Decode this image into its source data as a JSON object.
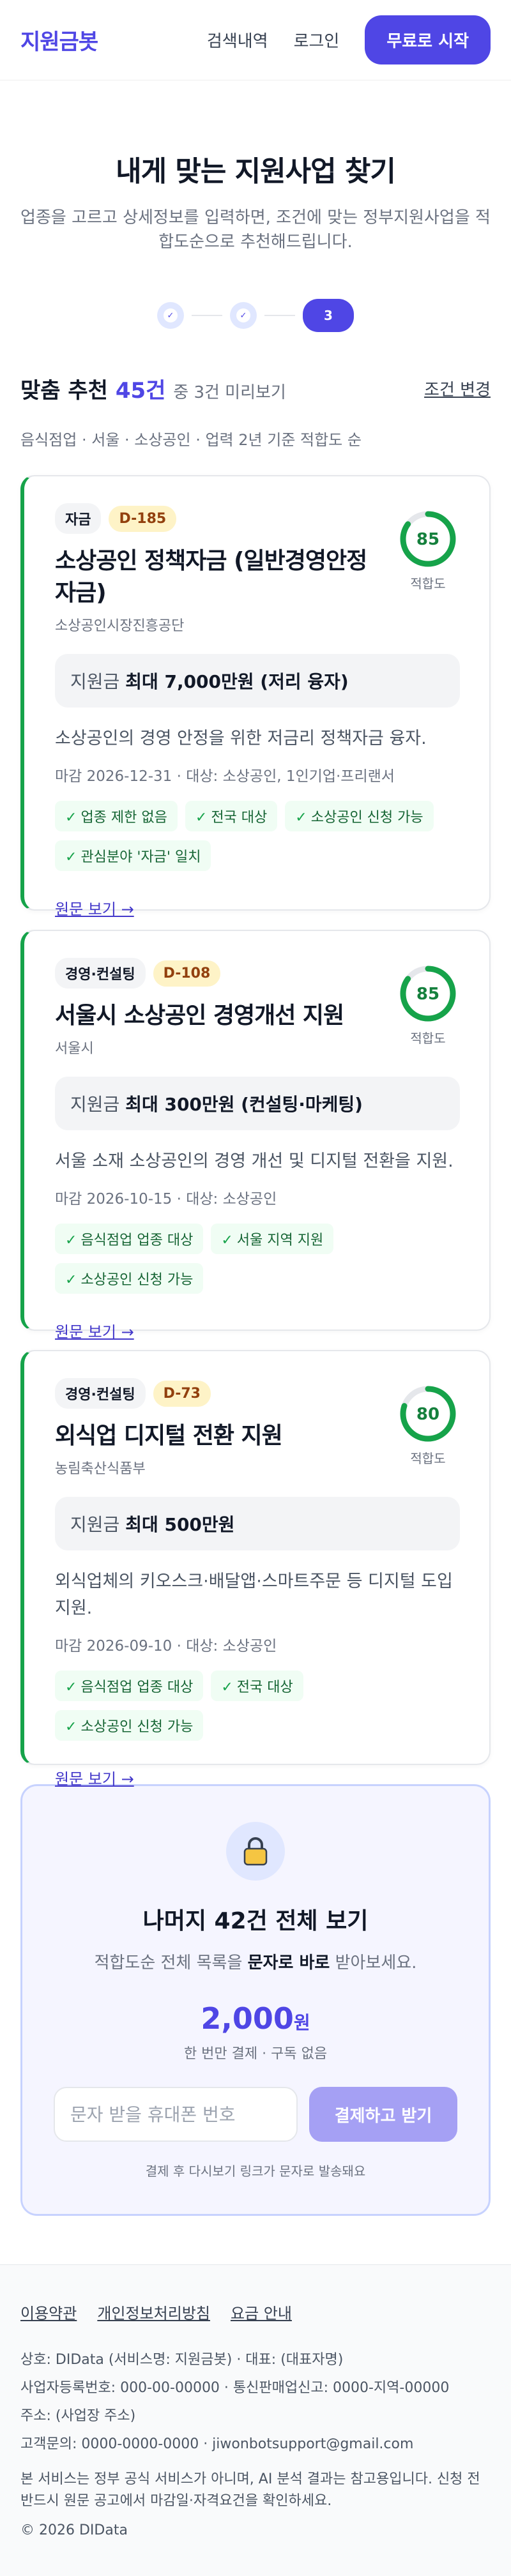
{
  "header": {
    "logo": "지원금봇",
    "nav": [
      "검색내역",
      "로그인"
    ],
    "cta": "무료로 시작"
  },
  "hero": {
    "title": "내게 맞는 지원사업 찾기",
    "subtitle": "업종을 고르고 상세정보를 입력하면, 조건에 맞는 정부지원사업을 적합도순으로 추천해드립니다."
  },
  "stepper": {
    "steps": [
      "✓",
      "✓",
      "3"
    ]
  },
  "results": {
    "title_prefix": "맞춤 추천",
    "count": "45건",
    "preview": "중 3건 미리보기",
    "change_label": "조건 변경",
    "criteria": "음식점업 · 서울 · 소상공인 · 업력 2년 기준 적합도 순"
  },
  "cards": [
    {
      "category": "자금",
      "dday": "D-185",
      "title": "소상공인 정책자금 (일반경영안정자금)",
      "org": "소상공인시장진흥공단",
      "score": 85,
      "score_label": "적합도",
      "support_prefix": "지원금",
      "support_value": "최대 7,000만원 (저리 융자)",
      "desc": "소상공인의 경영 안정을 위한 저금리 정책자금 융자.",
      "meta": "마감 2026-12-31 · 대상: 소상공인, 1인기업·프리랜서",
      "chips": [
        "업종 제한 없음",
        "전국 대상",
        "소상공인 신청 가능",
        "관심분야 '자금' 일치"
      ],
      "link": "원문 보기 →"
    },
    {
      "category": "경영·컨설팅",
      "dday": "D-108",
      "title": "서울시 소상공인 경영개선 지원",
      "org": "서울시",
      "score": 85,
      "score_label": "적합도",
      "support_prefix": "지원금",
      "support_value": "최대 300만원 (컨설팅·마케팅)",
      "desc": "서울 소재 소상공인의 경영 개선 및 디지털 전환을 지원.",
      "meta": "마감 2026-10-15 · 대상: 소상공인",
      "chips": [
        "음식점업 업종 대상",
        "서울 지역 지원",
        "소상공인 신청 가능"
      ],
      "link": "원문 보기 →"
    },
    {
      "category": "경영·컨설팅",
      "dday": "D-73",
      "title": "외식업 디지털 전환 지원",
      "org": "농림축산식품부",
      "score": 80,
      "score_label": "적합도",
      "support_prefix": "지원금",
      "support_value": "최대 500만원",
      "desc": "외식업체의 키오스크·배달앱·스마트주문 등 디지털 도입 지원.",
      "meta": "마감 2026-09-10 · 대상: 소상공인",
      "chips": [
        "음식점업 업종 대상",
        "전국 대상",
        "소상공인 신청 가능"
      ],
      "link": "원문 보기 →"
    }
  ],
  "paywall": {
    "lock_icon": "lock-icon",
    "title": "나머지 42건 전체 보기",
    "sub_prefix": "적합도순 전체 목록을",
    "sub_bold": "문자로 바로",
    "sub_suffix": "받아보세요.",
    "price": "2,000",
    "price_unit": "원",
    "note": "한 번만 결제 · 구독 없음",
    "input_placeholder": "문자 받을 휴대폰 번호",
    "button": "결제하고 받기",
    "foot": "결제 후 다시보기 링크가 문자로 발송돼요"
  },
  "footer": {
    "links": [
      "이용약관",
      "개인정보처리방침",
      "요금 안내"
    ],
    "info": [
      "상호: DIData (서비스명: 지원금봇) · 대표: (대표자명)",
      "사업자등록번호: 000-00-00000 · 통신판매업신고: 0000-지역-00000",
      "주소: (사업장 주소)",
      "고객문의: 0000-0000-0000 · jiwonbotsupport@gmail.com"
    ],
    "disclaimer": "본 서비스는 정부 공식 서비스가 아니며, AI 분석 결과는 참고용입니다. 신청 전 반드시 원문 공고에서 마감일·자격요건을 확인하세요.",
    "copyright": "© 2026 DIData"
  },
  "colors": {
    "brand": "#4f46e5",
    "success": "#16a34a",
    "dday_bg": "#fef3c7"
  }
}
